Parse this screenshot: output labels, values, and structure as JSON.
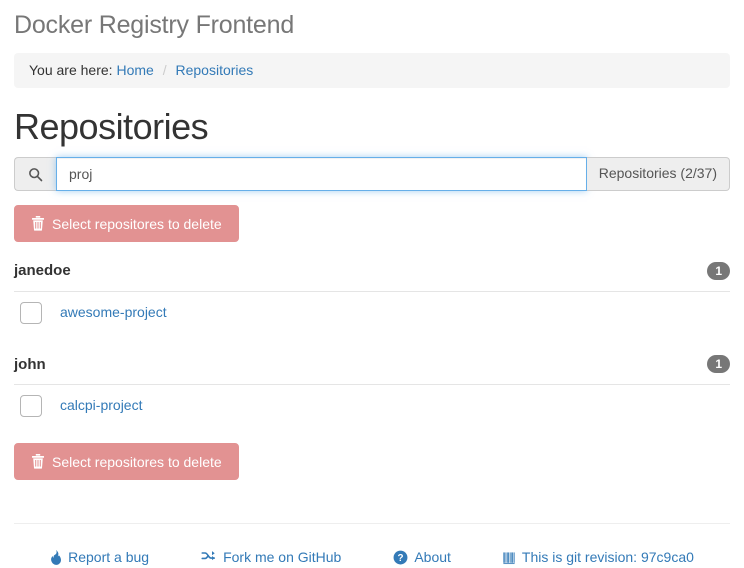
{
  "app": {
    "title": "Docker Registry Frontend"
  },
  "breadcrumb": {
    "label": "You are here:",
    "items": [
      {
        "text": "Home",
        "link": true
      },
      {
        "text": "Repositories",
        "link": true
      }
    ],
    "separator": "/"
  },
  "page": {
    "heading": "Repositories"
  },
  "search": {
    "icon": "search-icon",
    "value": "proj",
    "placeholder": "",
    "count_label": "Repositories (2/37)"
  },
  "actions": {
    "delete_top_label": "Select repositores to delete",
    "delete_bottom_label": "Select repositores to delete",
    "delete_icon": "trash-icon",
    "delete_color": "#e29292"
  },
  "groups": [
    {
      "name": "janedoe",
      "count": "1",
      "repos": [
        {
          "name": "awesome-project",
          "checked": false
        }
      ]
    },
    {
      "name": "john",
      "count": "1",
      "repos": [
        {
          "name": "calcpi-project",
          "checked": false
        }
      ]
    }
  ],
  "footer": {
    "links": [
      {
        "icon": "fire-icon",
        "text": "Report a bug"
      },
      {
        "icon": "shuffle-icon",
        "text": "Fork me on GitHub"
      },
      {
        "icon": "question-circle-icon",
        "text": "About"
      },
      {
        "icon": "barcode-icon",
        "text": "This is git revision: 97c9ca0"
      }
    ]
  },
  "colors": {
    "link": "#337ab7",
    "danger": "#e29292",
    "badge": "#777777",
    "focus_border": "#66afe9"
  }
}
